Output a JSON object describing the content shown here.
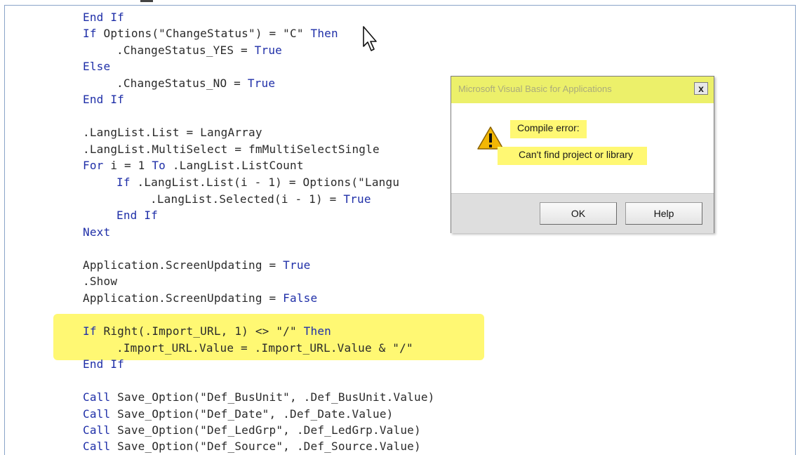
{
  "editor": {
    "lines": [
      {
        "parts": [
          {
            "t": "End If",
            "kw": true
          }
        ]
      },
      {
        "parts": [
          {
            "t": "If",
            "kw": true
          },
          {
            "t": " Options(\"ChangeStatus\") = \"C\" "
          },
          {
            "t": "Then",
            "kw": true
          }
        ]
      },
      {
        "parts": [
          {
            "t": ".ChangeStatus_YES = "
          },
          {
            "t": "True",
            "kw": true
          }
        ]
      },
      {
        "parts": [
          {
            "t": "Else",
            "kw": true
          }
        ]
      },
      {
        "parts": [
          {
            "t": ".ChangeStatus_NO = "
          },
          {
            "t": "True",
            "kw": true
          }
        ]
      },
      {
        "parts": [
          {
            "t": "End If",
            "kw": true
          }
        ]
      },
      {
        "parts": [
          {
            "t": ".LangList.List = LangArray"
          }
        ]
      },
      {
        "parts": [
          {
            "t": ".LangList.MultiSelect = fmMultiSelectSingle"
          }
        ]
      },
      {
        "parts": [
          {
            "t": "For",
            "kw": true
          },
          {
            "t": " i = 1 "
          },
          {
            "t": "To",
            "kw": true
          },
          {
            "t": " .LangList.ListCount"
          }
        ]
      },
      {
        "parts": [
          {
            "t": "If",
            "kw": true
          },
          {
            "t": " .LangList.List(i - 1) = Options(\"Langu"
          }
        ]
      },
      {
        "parts": [
          {
            "t": ".LangList.Selected(i - 1) = "
          },
          {
            "t": "True",
            "kw": true
          }
        ]
      },
      {
        "parts": [
          {
            "t": "End If",
            "kw": true
          }
        ]
      },
      {
        "parts": [
          {
            "t": "Next",
            "kw": true
          }
        ]
      },
      {
        "parts": [
          {
            "t": "Application.ScreenUpdating = "
          },
          {
            "t": "True",
            "kw": true
          }
        ]
      },
      {
        "parts": [
          {
            "t": ".Show"
          }
        ]
      },
      {
        "parts": [
          {
            "t": "Application.ScreenUpdating = "
          },
          {
            "t": "False",
            "kw": true
          }
        ]
      },
      {
        "parts": [
          {
            "t": "If",
            "kw": true
          },
          {
            "t": " Right(.Import_URL, 1) <> \"/\" "
          },
          {
            "t": "Then",
            "kw": true
          }
        ]
      },
      {
        "parts": [
          {
            "t": ".Import_URL.Value = .Import_URL.Value & \"/\""
          }
        ]
      },
      {
        "parts": [
          {
            "t": "End If",
            "kw": true
          }
        ]
      },
      {
        "parts": [
          {
            "t": "Call",
            "kw": true
          },
          {
            "t": " Save_Option(\"Def_BusUnit\", .Def_BusUnit.Value)"
          }
        ]
      },
      {
        "parts": [
          {
            "t": "Call",
            "kw": true
          },
          {
            "t": " Save_Option(\"Def_Date\", .Def_Date.Value)"
          }
        ]
      },
      {
        "parts": [
          {
            "t": "Call",
            "kw": true
          },
          {
            "t": " Save_Option(\"Def_LedGrp\", .Def_LedGrp.Value)"
          }
        ]
      },
      {
        "parts": [
          {
            "t": "Call",
            "kw": true
          },
          {
            "t": " Save_Option(\"Def_Source\", .Def_Source.Value)"
          }
        ]
      }
    ]
  },
  "dialog": {
    "title": "Microsoft Visual Basic for Applications",
    "close_label": "x",
    "message_heading": "Compile error:",
    "message_body": "Can't find project or library",
    "ok_label": "OK",
    "help_label": "Help",
    "icon": "warning-icon"
  },
  "colors": {
    "keyword": "#1f2fa8",
    "highlight": "#fff873"
  }
}
